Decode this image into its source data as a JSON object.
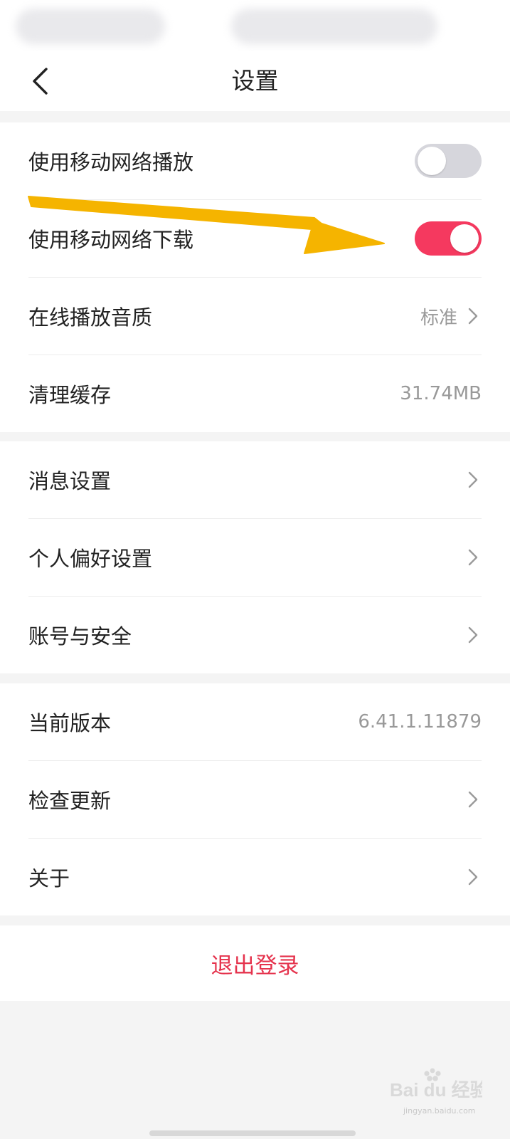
{
  "header": {
    "title": "设置",
    "back_icon": "chevron-left-icon"
  },
  "group1": {
    "items": [
      {
        "label": "使用移动网络播放",
        "control": "toggle",
        "enabled": false
      },
      {
        "label": "使用移动网络下载",
        "control": "toggle",
        "enabled": true
      },
      {
        "label": "在线播放音质",
        "value": "标准",
        "icon": "chevron-right-icon"
      },
      {
        "label": "清理缓存",
        "value": "31.74MB"
      }
    ]
  },
  "group2": {
    "items": [
      {
        "label": "消息设置",
        "icon": "chevron-right-icon"
      },
      {
        "label": "个人偏好设置",
        "icon": "chevron-right-icon"
      },
      {
        "label": "账号与安全",
        "icon": "chevron-right-icon"
      }
    ]
  },
  "group3": {
    "items": [
      {
        "label": "当前版本",
        "value": "6.41.1.11879"
      },
      {
        "label": "检查更新",
        "icon": "chevron-right-icon"
      },
      {
        "label": "关于",
        "icon": "chevron-right-icon"
      }
    ]
  },
  "logout": {
    "label": "退出登录"
  },
  "watermark": {
    "brand": "Bai du 经验",
    "url": "jingyan.baidu.com"
  },
  "colors": {
    "accent": "#f5395f",
    "logout_text": "#e5334d",
    "toggle_off": "#d6d6dc",
    "annotation_arrow": "#f5b400",
    "background": "#f4f4f4"
  }
}
